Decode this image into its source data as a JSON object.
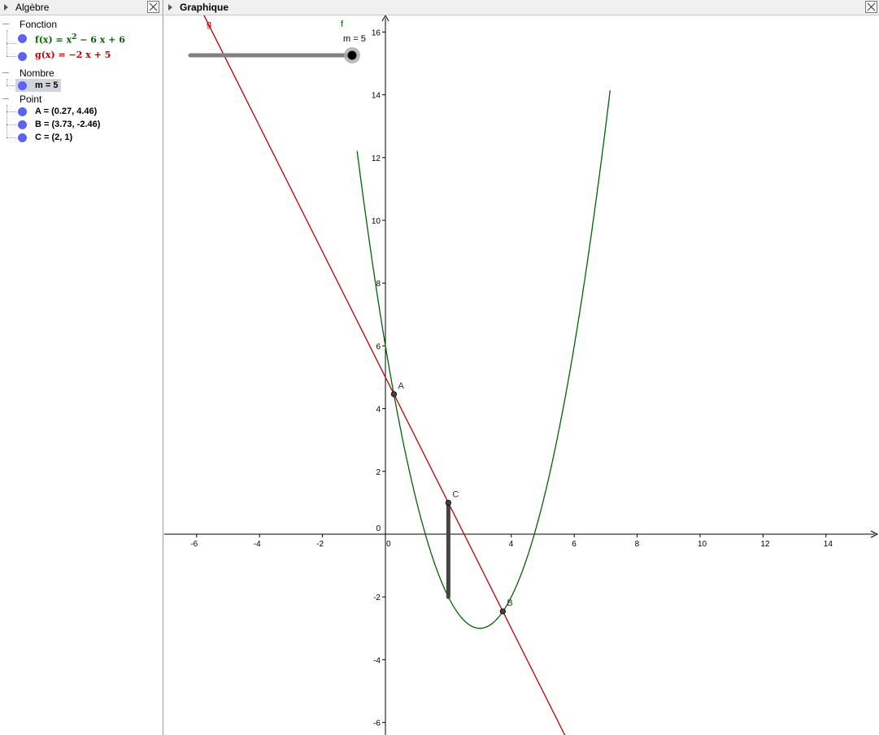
{
  "algebra": {
    "title": "Algèbre",
    "categories": [
      {
        "label": "Fonction"
      },
      {
        "label": "Nombre"
      },
      {
        "label": "Point"
      }
    ],
    "functions": [
      {
        "name": "f",
        "lhs": "f(x)",
        "rhs": " = x",
        "exp": "2",
        "rest": " − 6 x + 6",
        "color": "#006400"
      },
      {
        "name": "g",
        "lhs": "g(x)",
        "rhs": " = −2 x + 5",
        "color": "#c00000"
      }
    ],
    "numbers": [
      {
        "label": "m = 5"
      }
    ],
    "points": [
      {
        "label": "A = (0.27, 4.46)"
      },
      {
        "label": "B = (3.73, -2.46)"
      },
      {
        "label": "C = (2, 1)"
      }
    ]
  },
  "graphics": {
    "title": "Graphique",
    "slider": {
      "label": "m = 5",
      "value": 5
    },
    "colors": {
      "f": "#006400",
      "g": "#c00000",
      "axis": "#000000",
      "point": "#333333",
      "slider": "#808080"
    },
    "curve_labels": {
      "f": "f",
      "g": "g"
    },
    "points": [
      {
        "name": "A",
        "x": 0.27,
        "y": 4.46
      },
      {
        "name": "B",
        "x": 3.73,
        "y": -2.46
      },
      {
        "name": "C",
        "x": 2,
        "y": 1
      }
    ],
    "x_ticks": [
      "-6",
      "-4",
      "-2",
      "0",
      "4",
      "6",
      "8",
      "10",
      "12",
      "14"
    ],
    "y_ticks": [
      "16",
      "14",
      "12",
      "10",
      "8",
      "6",
      "4",
      "2",
      "0",
      "-2",
      "-4",
      "-6"
    ],
    "segment": {
      "x": 2,
      "y_from": -2,
      "y_to": 1
    }
  },
  "chart_data": {
    "type": "line",
    "series": [
      {
        "name": "f",
        "expression": "x^2 - 6x + 6"
      },
      {
        "name": "g",
        "expression": "-2x + 5"
      }
    ],
    "xlim": [
      -7,
      15.5
    ],
    "ylim": [
      -6.3,
      16.5
    ],
    "grid": false
  }
}
